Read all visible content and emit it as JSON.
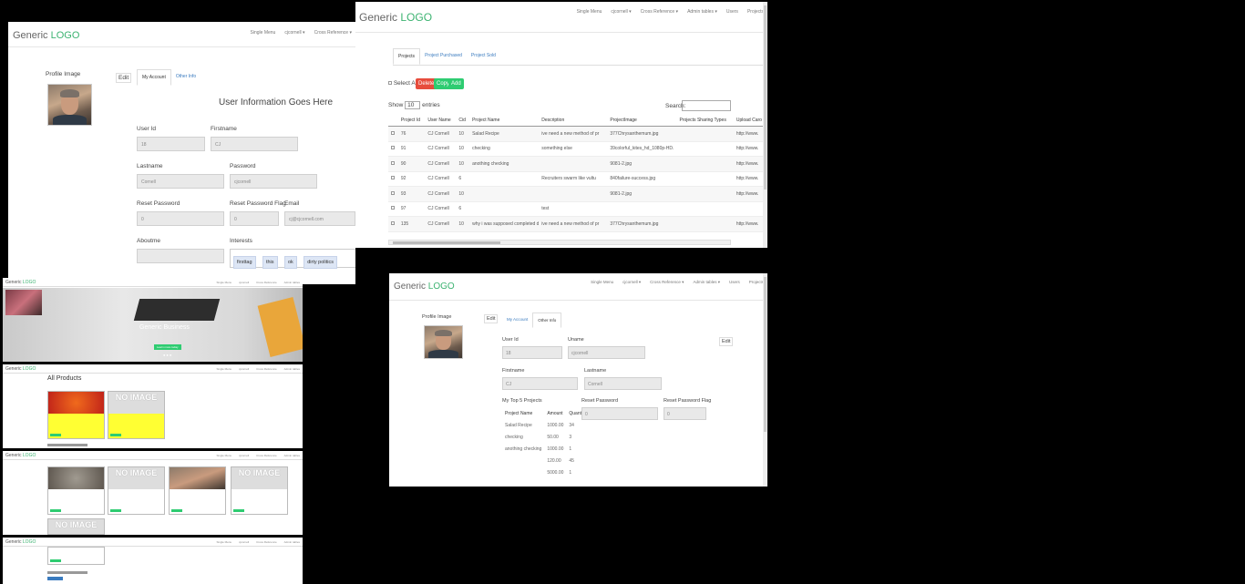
{
  "brand": {
    "part1": "Generic",
    "part2": "LOGO"
  },
  "profile_panel": {
    "nav": [
      "Single Menu",
      "cjcornell ▾",
      "Cross Reference ▾"
    ],
    "image_label": "Profile Image",
    "edit_label": "Edit",
    "tabs": [
      "My Account",
      "Other Info"
    ],
    "heading": "User Information Goes Here",
    "fields": {
      "user_id": {
        "label": "User Id",
        "value": "18"
      },
      "firstname": {
        "label": "Firstname",
        "value": "CJ"
      },
      "lastname": {
        "label": "Lastname",
        "value": "Cornell"
      },
      "password": {
        "label": "Password",
        "value": "cjcornell"
      },
      "reset_password": {
        "label": "Reset Password",
        "value": "0"
      },
      "reset_password_flag": {
        "label": "Reset Password Flag",
        "value": "0"
      },
      "email": {
        "label": "Email",
        "value": "cj@cjcornell.com"
      },
      "aboutme": {
        "label": "Aboutme",
        "value": ""
      },
      "interests": {
        "label": "Interests",
        "tags": [
          "firsttag",
          "this",
          "ok",
          "dirty politics"
        ]
      }
    }
  },
  "projects_panel": {
    "nav": [
      "Single Menu",
      "cjcornell ▾",
      "Cross Reference ▾",
      "Admin tables ▾",
      "Users",
      "Projects"
    ],
    "tabs": [
      "Projects",
      "Project Purchased",
      "Project Sold"
    ],
    "select_all": "Select All",
    "buttons": {
      "delete": "Delete",
      "copy": "Copy",
      "add": "Add"
    },
    "show_label": "Show",
    "entries_value": "10",
    "entries_label": "entries",
    "search_label": "Search:",
    "columns": [
      "Project Id",
      "User Name",
      "Cid",
      "Project Name",
      "Description",
      "ProjectImage",
      "Projects Sharing Types",
      "Upload Caro"
    ],
    "rows": [
      [
        "76",
        "CJ Cornell",
        "10",
        "Salad Recipe",
        "ive need a new method of pr",
        "377Chrysanthemum.jpg",
        "",
        "http://www."
      ],
      [
        "91",
        "CJ Cornell",
        "10",
        "checking",
        "something else",
        "39colorful_kites_hd_1080p-HD.",
        "",
        "http://www."
      ],
      [
        "90",
        "CJ Cornell",
        "10",
        "anothing checking",
        "",
        "9081-2.jpg",
        "",
        "http://www."
      ],
      [
        "92",
        "CJ Cornell",
        "6",
        "",
        "Recruiters swarm like vultu",
        "840failure-success.jpg",
        "",
        "http://www."
      ],
      [
        "93",
        "CJ Cornell",
        "10",
        "",
        "",
        "9081-2.jpg",
        "",
        "http://www."
      ],
      [
        "97",
        "CJ Cornell",
        "6",
        "",
        "test",
        "",
        "",
        ""
      ],
      [
        "135",
        "CJ Cornell",
        "10",
        "why i was supposed completed di",
        "ive need a new method of pr",
        "377Chrysanthemum.jpg",
        "",
        "http://www."
      ]
    ]
  },
  "other_info_panel": {
    "nav": [
      "Single Menu",
      "cjcornell ▾",
      "Cross Reference ▾",
      "Admin tables ▾",
      "Users",
      "Projects"
    ],
    "image_label": "Profile Image",
    "edit_label": "Edit",
    "edit_label2": "Edit",
    "tabs": [
      "My Account",
      "Other Info"
    ],
    "fields": {
      "user_id": {
        "label": "User Id",
        "value": "18"
      },
      "uname": {
        "label": "Uname",
        "value": "cjcornell"
      },
      "firstname": {
        "label": "Firstname",
        "value": "CJ"
      },
      "lastname": {
        "label": "Lastname",
        "value": "Cornell"
      },
      "reset_password": {
        "label": "Reset Password",
        "value": "0"
      },
      "reset_password_flag": {
        "label": "Reset Password Flag",
        "value": "0"
      }
    },
    "top5": {
      "label": "My Top 5 Projects",
      "columns": [
        "Project Name",
        "Amount",
        "Quantity"
      ],
      "rows": [
        [
          "Salad Recipe",
          "1000.00",
          "34"
        ],
        [
          "checking",
          "50.00",
          "3"
        ],
        [
          "anothing checking",
          "1000.00",
          "1"
        ],
        [
          "",
          "120.00",
          "45"
        ],
        [
          "",
          "5000.00",
          "1"
        ]
      ]
    }
  },
  "thumbnails": {
    "nav": [
      "Single Menu",
      "cjcornell",
      "Cross Reference",
      "Admin tables"
    ],
    "hero_title": "Generic Business",
    "hero_button": "Learn more today",
    "all_products": "All Products",
    "no_image": "NO IMAGE"
  }
}
